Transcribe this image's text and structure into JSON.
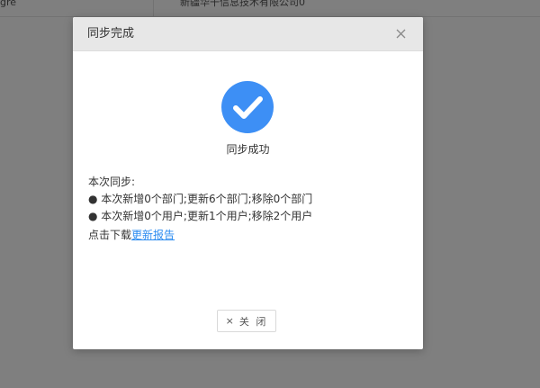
{
  "background": {
    "cell_left": "gre",
    "cell_right": "新疆华干信息技术有限公司0"
  },
  "modal": {
    "title": "同步完成",
    "close_icon": "close-icon",
    "success_icon": "check-circle-icon",
    "success_color": "#3d8ff5",
    "success_text": "同步成功",
    "details_heading": "本次同步:",
    "details_lines": [
      "● 本次新增0个部门;更新6个部门;移除0个部门",
      "● 本次新增0个用户;更新1个用户;移除2个用户"
    ],
    "download_prefix": "点击下载",
    "download_link": "更新报告",
    "close_button_icon": "×",
    "close_button_label": "关 闭"
  }
}
